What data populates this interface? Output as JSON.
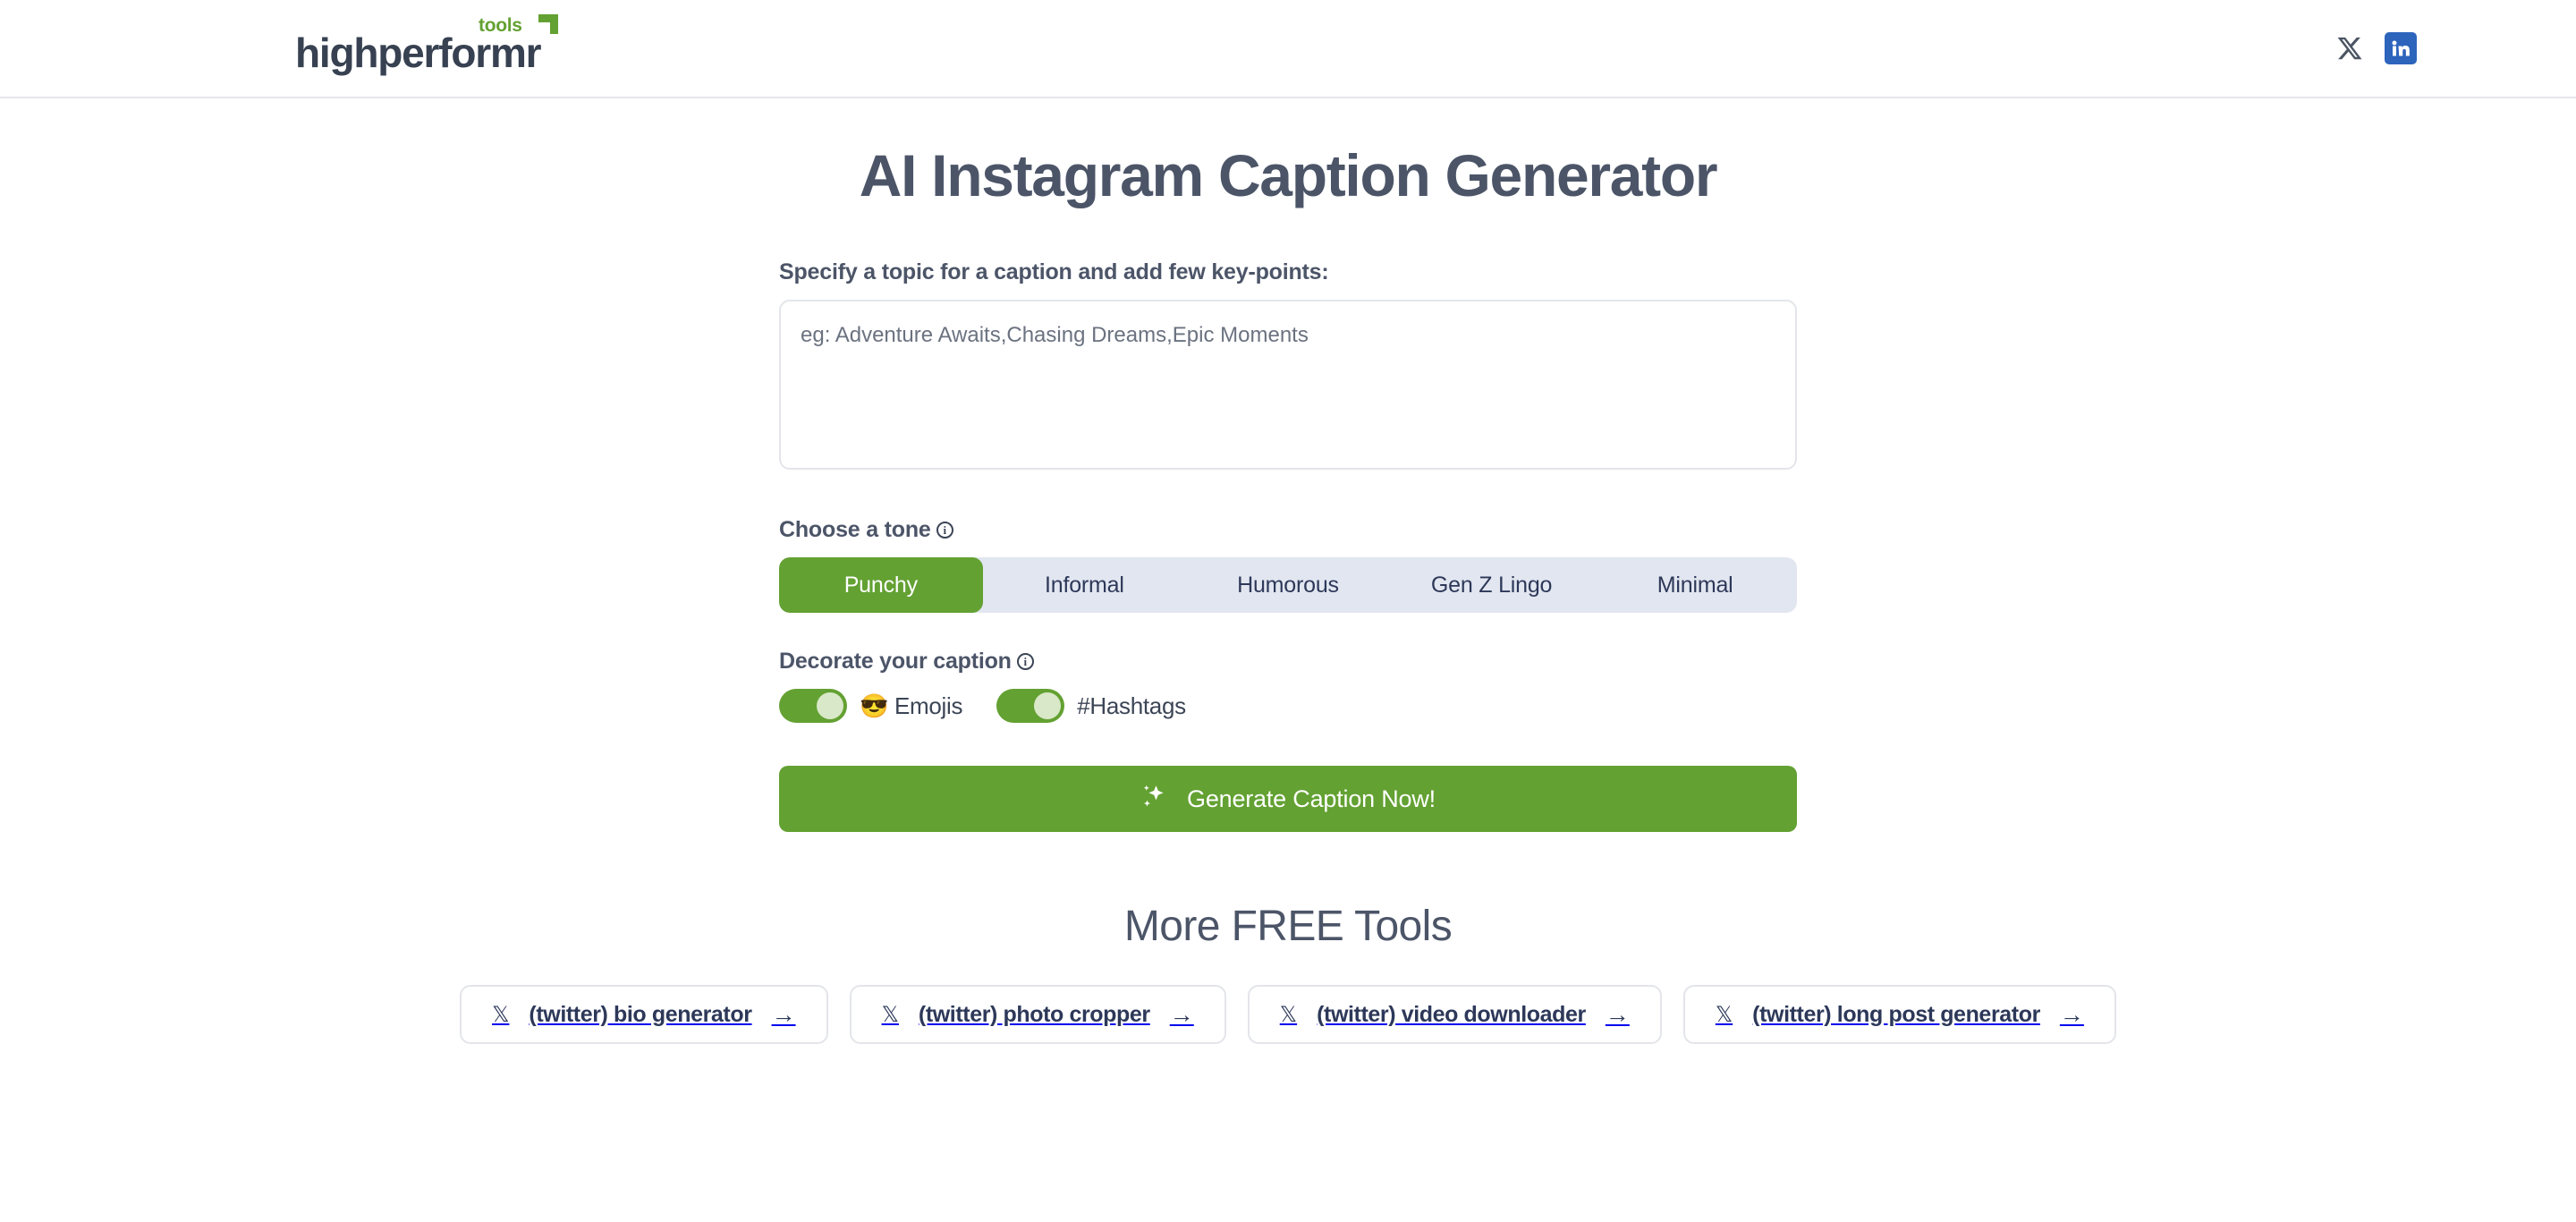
{
  "header": {
    "brand_word": "highperformr",
    "brand_suffix": "tools",
    "social": [
      {
        "name": "x-twitter",
        "label": "X"
      },
      {
        "name": "linkedin",
        "label": "in"
      }
    ]
  },
  "main": {
    "title": "AI Instagram Caption Generator",
    "topic": {
      "label": "Specify a topic for a caption and add few key-points:",
      "placeholder": "eg: Adventure Awaits,Chasing Dreams,Epic Moments",
      "value": ""
    },
    "tone": {
      "label": "Choose a tone",
      "info_icon": "info-icon",
      "selected": "Punchy",
      "options": [
        {
          "label": "Punchy"
        },
        {
          "label": "Informal"
        },
        {
          "label": "Humorous"
        },
        {
          "label": "Gen Z Lingo"
        },
        {
          "label": "Minimal"
        }
      ]
    },
    "decorate": {
      "label": "Decorate your caption",
      "info_icon": "info-icon",
      "toggles": [
        {
          "label": "😎 Emojis",
          "state": "on"
        },
        {
          "label": "#Hashtags",
          "state": "on"
        }
      ]
    },
    "cta": {
      "icon": "sparkles-icon",
      "label": "Generate Caption Now!"
    }
  },
  "more_tools": {
    "heading": "More FREE Tools",
    "items": [
      {
        "icon": "𝕏",
        "label": "(twitter) bio generator",
        "arrow": "→"
      },
      {
        "icon": "𝕏",
        "label": "(twitter) photo cropper",
        "arrow": "→"
      },
      {
        "icon": "𝕏",
        "label": "(twitter) video downloader",
        "arrow": "→"
      },
      {
        "icon": "𝕏",
        "label": "(twitter) long post generator",
        "arrow": "→"
      }
    ]
  },
  "colors": {
    "accent_green": "#63a132",
    "text_slate": "#4c5568",
    "tone_bar_bg": "#e2e6f0",
    "linkedin_blue": "#2d64bc"
  }
}
